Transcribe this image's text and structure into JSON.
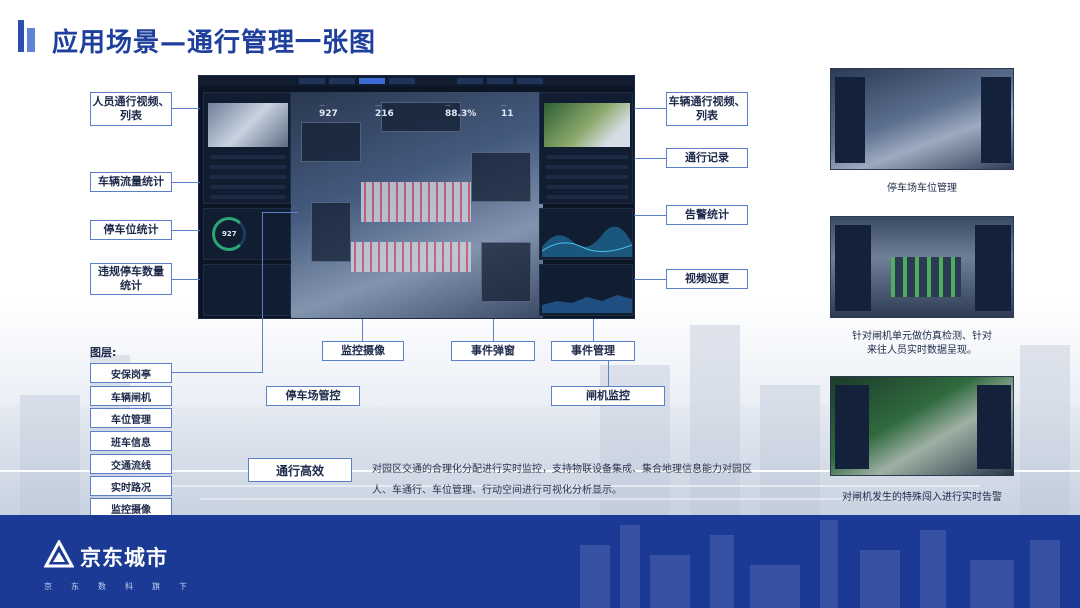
{
  "page": {
    "title": "应用场景—通行管理一张图"
  },
  "callouts": {
    "person_video": "人员通行视频、\n列表",
    "vehicle_flow": "车辆流量统计",
    "parking_stats": "停车位统计",
    "illegal_parking": "违规停车数量\n统计",
    "vehicle_video": "车辆通行视频、\n列表",
    "pass_record": "通行记录",
    "alarm_stats": "告警统计",
    "video_patrol": "视频巡更",
    "monitor_camera": "监控摄像",
    "event_popup": "事件弹窗",
    "event_mgmt": "事件管理",
    "parking_ctrl": "停车场管控",
    "gate_monitor": "闸机监控"
  },
  "layers": {
    "heading": "图层:",
    "items": [
      "安保岗亭",
      "车辆闸机",
      "车位管理",
      "班车信息",
      "交通流线",
      "实时路况",
      "监控摄像"
    ]
  },
  "efficiency": {
    "label": "通行高效",
    "description": "对园区交通的合理化分配进行实时监控，支持物联设备集成、集合地理信息能力对园区人、车通行、车位管理、行动空间进行可视化分析显示。"
  },
  "dashboard": {
    "kpis": [
      {
        "value": "927"
      },
      {
        "value": "216"
      },
      {
        "value": "88.3%"
      },
      {
        "value": "11"
      }
    ],
    "ring_value": "927"
  },
  "thumbnails": [
    {
      "caption": "停车场车位管理"
    },
    {
      "caption": "针对闸机单元做仿真检测、针对\n来往人员实时数据呈现。"
    },
    {
      "caption": "对闸机发生的特殊闯入进行实时告警"
    }
  ],
  "footer": {
    "brand": "京东城市",
    "slogan": "京东数科旗下"
  },
  "colors": {
    "primary": "#1f3f9c",
    "accent": "#5b7fc9",
    "footer": "#1b3a95"
  }
}
